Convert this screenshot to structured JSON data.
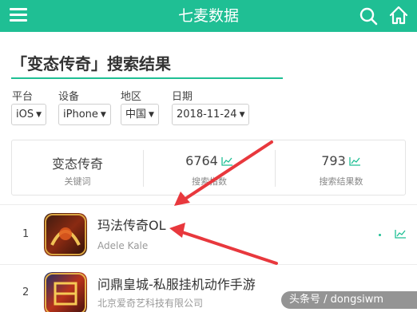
{
  "app": {
    "title": "七麦数据"
  },
  "page": {
    "title": "「变态传奇」搜索结果"
  },
  "filters": [
    {
      "label": "平台",
      "value": "iOS"
    },
    {
      "label": "设备",
      "value": "iPhone"
    },
    {
      "label": "地区",
      "value": "中国"
    },
    {
      "label": "日期",
      "value": "2018-11-24"
    }
  ],
  "stats": {
    "keyword": {
      "value": "变态传奇",
      "label": "关键词"
    },
    "index": {
      "value": "6764",
      "label": "搜索指数"
    },
    "results": {
      "value": "793",
      "label": "搜索结果数"
    }
  },
  "results": [
    {
      "rank": "1",
      "name": "玛法传奇OL",
      "developer": "Adele Kale"
    },
    {
      "rank": "2",
      "name": "问鼎皇城-私服挂机动作手游",
      "developer": "北京爱奇艺科技有限公司"
    }
  ],
  "watermark": "头条号 / dongsiwm",
  "colors": {
    "accent": "#1fbf94",
    "arrow": "#e8383d"
  },
  "icons": {
    "menu": "hamburger",
    "search": "magnifier",
    "home": "house",
    "trend": "line-chart"
  }
}
